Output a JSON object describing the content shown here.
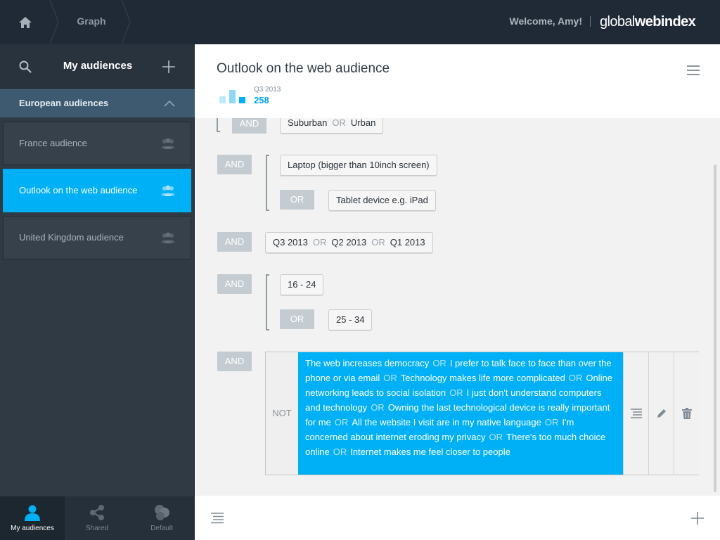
{
  "topbar": {
    "breadcrumb_graph": "Graph",
    "welcome": "Welcome, Amy!",
    "brand_light": "global",
    "brand_heavy": "webindex"
  },
  "sidebar": {
    "title": "My audiences",
    "group_label": "European audiences",
    "items": [
      {
        "label": "France audience"
      },
      {
        "label": "Outlook on the web audience"
      },
      {
        "label": "United Kingdom audience"
      }
    ],
    "bottom_nav": [
      {
        "label": "My audiences"
      },
      {
        "label": "Shared"
      },
      {
        "label": "Default"
      }
    ]
  },
  "main": {
    "title": "Outlook on the web audience",
    "period": "Q3 2013",
    "count": "258",
    "ops": {
      "and": "AND",
      "or": "OR",
      "not": "NOT"
    },
    "rows": {
      "r1": {
        "a": "Suburban",
        "b": "Urban"
      },
      "r2": {
        "a": "Laptop (bigger than 10inch screen)",
        "b": "Tablet device e.g. iPad"
      },
      "r3": {
        "a": "Q3 2013",
        "b": "Q2 2013",
        "c": "Q1 2013"
      },
      "r4": {
        "a": "16 - 24",
        "b": "25 - 34"
      },
      "not_items": [
        "The web increases democracy",
        "I prefer to talk face to face than over the phone or via email",
        "Technology makes life more complicated",
        "Online networking leads to social isolation",
        "I just don't understand computers and technology",
        "Owning the last technological device is really important for me",
        "All the website I visit are in my native language",
        "I'm concerned about internet eroding my privacy",
        "There's too much choice online",
        "Internet makes me feel closer to people"
      ]
    }
  },
  "colors": {
    "accent": "#00b0f6",
    "topbar": "#1f2a36",
    "sidebar": "#2f3a45",
    "group_header": "#3e5a70"
  },
  "icons": {
    "home": "home-icon",
    "search": "search-icon",
    "add": "plus-icon",
    "chevron": "chevron-up-icon",
    "audience": "people-icon",
    "menu": "hamburger-icon",
    "details": "list-icon",
    "edit": "pencil-icon",
    "delete": "trash-icon"
  }
}
